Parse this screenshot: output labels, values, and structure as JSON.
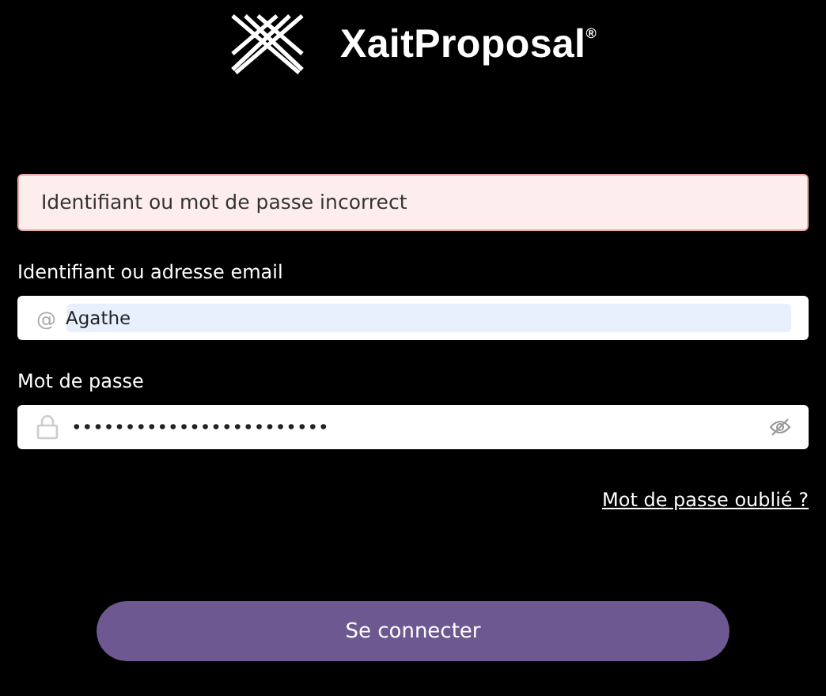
{
  "brand": {
    "name": "XaitProposal$^{®}$"
  },
  "error": {
    "message": "Identifiant ou mot de passe incorrect"
  },
  "fields": [
    {
      "kind": "text",
      "label": "Identifiant ou adresse email",
      "prefix": "@",
      "value": "Agathe",
      "autofilled": true
    },
    {
      "kind": "password",
      "label": "Mot de passe",
      "value": "••••••••••••••••••••••••",
      "autofilled": false
    }
  ],
  "forgot_link": "Mot de passe oublié ?",
  "submit_button": "Se connecter"
}
